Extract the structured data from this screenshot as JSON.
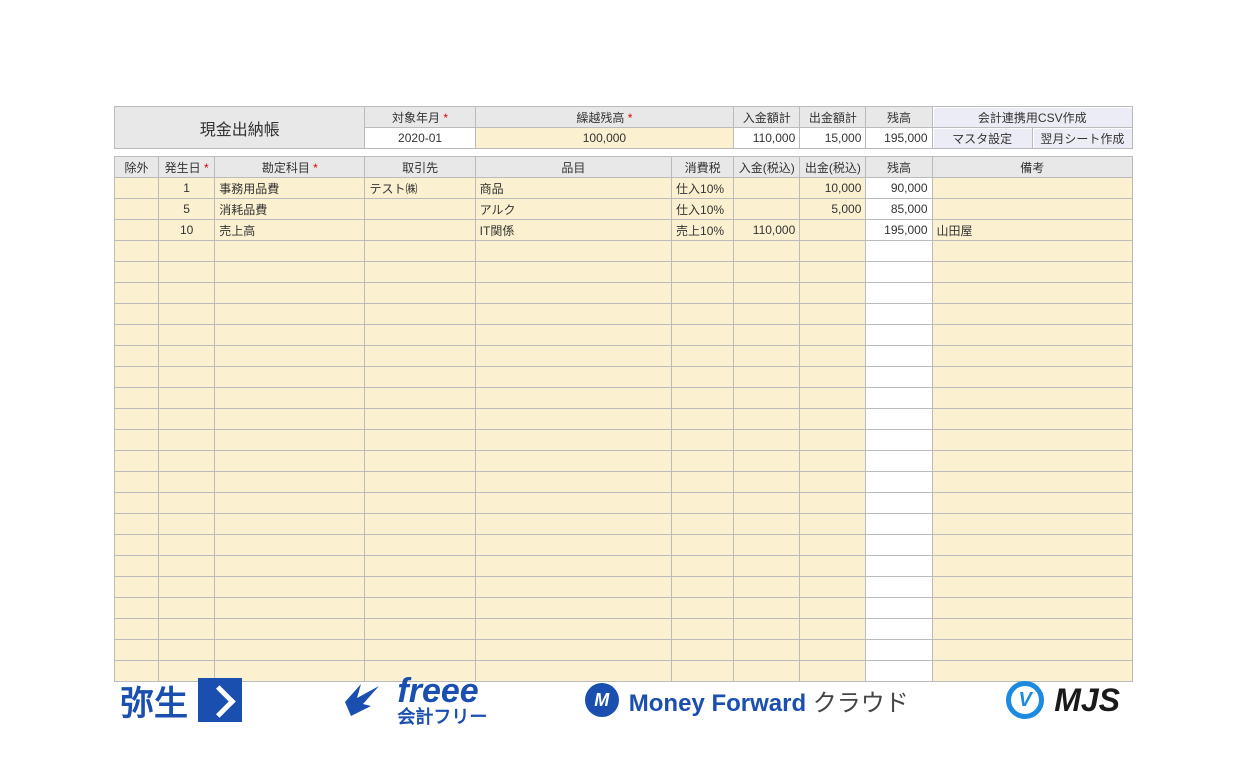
{
  "header": {
    "title": "現金出納帳",
    "labels": {
      "target_month": "対象年月",
      "opening_balance": "繰越残高",
      "income_total": "入金額計",
      "expense_total": "出金額計",
      "balance": "残高"
    },
    "values": {
      "target_month": "2020-01",
      "opening_balance": "100,000",
      "income_total": "110,000",
      "expense_total": "15,000",
      "balance": "195,000"
    },
    "buttons": {
      "csv": "会計連携用CSV作成",
      "master": "マスタ設定",
      "next_sheet": "翌月シート作成"
    }
  },
  "columns": {
    "exclude": "除外",
    "day": "発生日",
    "account": "勘定科目",
    "vendor": "取引先",
    "item": "品目",
    "tax": "消費税",
    "income": "入金(税込)",
    "expense": "出金(税込)",
    "balance": "残高",
    "note": "備考"
  },
  "rows": [
    {
      "day": "1",
      "account": "事務用品費",
      "vendor": "テスト㈱",
      "item": "商品",
      "tax": "仕入10%",
      "income": "",
      "expense": "10,000",
      "balance": "90,000",
      "note": ""
    },
    {
      "day": "5",
      "account": "消耗品費",
      "vendor": "",
      "item": "アルク",
      "tax": "仕入10%",
      "income": "",
      "expense": "5,000",
      "balance": "85,000",
      "note": ""
    },
    {
      "day": "10",
      "account": "売上高",
      "vendor": "",
      "item": "IT関係",
      "tax": "売上10%",
      "income": "110,000",
      "expense": "",
      "balance": "195,000",
      "note": "山田屋"
    }
  ],
  "empty_rows": 21,
  "logos": {
    "yayoi": "弥生",
    "freee_script": "freee",
    "freee_sub": "会計フリー",
    "mf_bold": "Money Forward",
    "mf_grey": " クラウド",
    "mjs": "MJS"
  }
}
